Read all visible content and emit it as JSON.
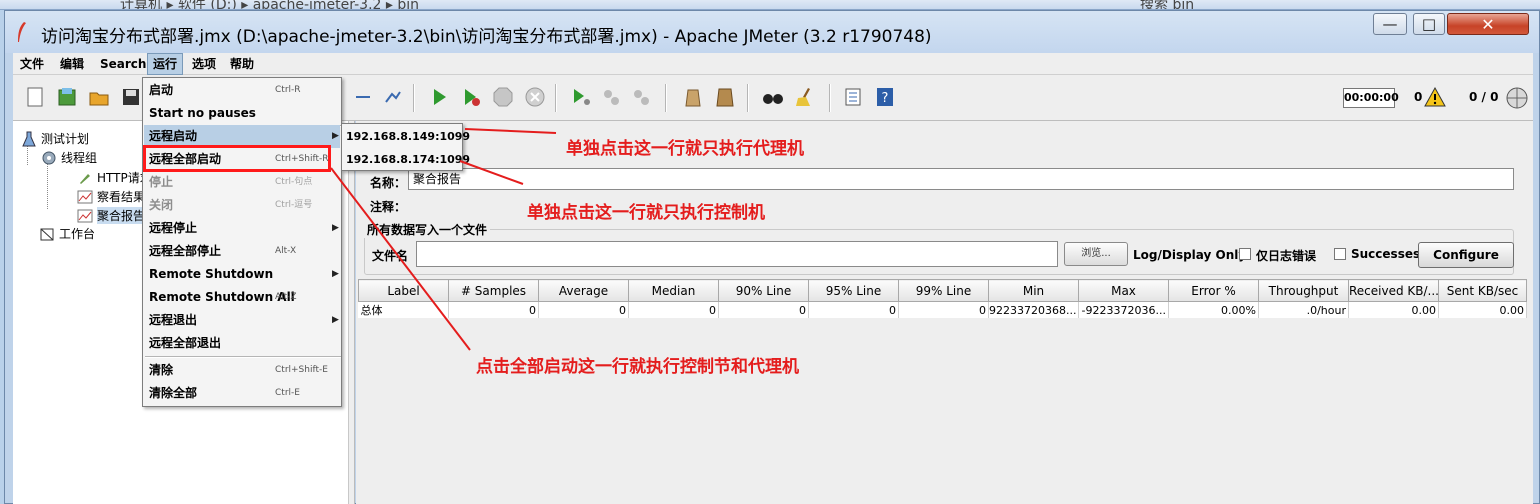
{
  "explorer": {
    "breadcrumb": "计算机 ▸ 软件 (D:) ▸ apache-jmeter-3.2 ▸ bin",
    "search_placeholder": "搜索 bin"
  },
  "window": {
    "title": "访问淘宝分布式部署.jmx (D:\\apache-jmeter-3.2\\bin\\访问淘宝分布式部署.jmx) - Apache JMeter (3.2 r1790748)",
    "minimize": "—",
    "maximize": "□",
    "close": "✕"
  },
  "menubar": {
    "items": [
      {
        "label": "文件"
      },
      {
        "label": "编辑"
      },
      {
        "label": "Search"
      },
      {
        "label": "运行"
      },
      {
        "label": "选项"
      },
      {
        "label": "帮助"
      }
    ]
  },
  "toolbar": {
    "timer": "00:00:00",
    "warnings": "0",
    "threads": "0 / 0"
  },
  "tree": {
    "items": [
      {
        "label": "测试计划"
      },
      {
        "label": "线程组"
      },
      {
        "label": "HTTP请求"
      },
      {
        "label": "察看结果树"
      },
      {
        "label": "聚合报告"
      },
      {
        "label": "工作台"
      }
    ]
  },
  "run_menu": {
    "items": [
      {
        "label": "启动",
        "accel": "Ctrl-R"
      },
      {
        "label": "Start no pauses",
        "accel": ""
      },
      {
        "label": "远程启动",
        "accel": ""
      },
      {
        "label": "远程全部启动",
        "accel": "Ctrl+Shift-R"
      },
      {
        "label": "停止",
        "accel": "Ctrl-句点"
      },
      {
        "label": "关闭",
        "accel": "Ctrl-逗号"
      },
      {
        "label": "远程停止",
        "accel": ""
      },
      {
        "label": "远程全部停止",
        "accel": "Alt-X"
      },
      {
        "label": "Remote Shutdown",
        "accel": ""
      },
      {
        "label": "Remote Shutdown All",
        "accel": "Alt-Z"
      },
      {
        "label": "远程退出",
        "accel": ""
      },
      {
        "label": "远程全部退出",
        "accel": ""
      },
      {
        "label": "清除",
        "accel": "Ctrl+Shift-E"
      },
      {
        "label": "清除全部",
        "accel": "Ctrl-E"
      }
    ]
  },
  "remote_submenu": {
    "items": [
      {
        "label": "192.168.8.149:1099"
      },
      {
        "label": "192.168.8.174:1099"
      }
    ]
  },
  "panel": {
    "name_label": "名称：",
    "name_value": "聚合报告",
    "comment_label": "注释：",
    "file_group_title": "所有数据写入一个文件",
    "filename_label": "文件名",
    "filename_value": "",
    "browse_label": "浏览...",
    "log_display": "Log/Display Only:",
    "errors_only": "仅日志错误",
    "successes": "Successes",
    "configure": "Configure"
  },
  "results_table": {
    "headers": [
      "Label",
      "# Samples",
      "Average",
      "Median",
      "90% Line",
      "95% Line",
      "99% Line",
      "Min",
      "Max",
      "Error %",
      "Throughput",
      "Received KB/...",
      "Sent KB/sec"
    ],
    "rows": [
      [
        "总体",
        "0",
        "0",
        "0",
        "0",
        "0",
        "0",
        "92233720368...",
        "-9223372036...",
        "0.00%",
        ".0/hour",
        "0.00",
        "0.00"
      ]
    ]
  },
  "annotations": {
    "note1": "单独点击这一行就只执行代理机",
    "note2": "单独点击这一行就只执行控制机",
    "note3": "点击全部启动这一行就执行控制节和代理机",
    "color": "#e41d1d"
  }
}
